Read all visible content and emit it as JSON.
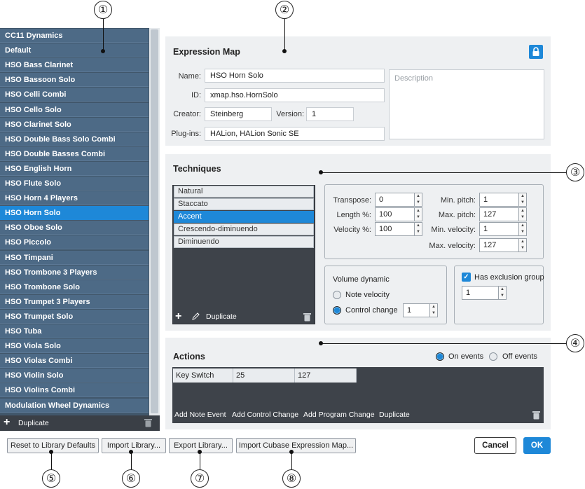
{
  "library": {
    "items": [
      "CC11 Dynamics",
      "Default",
      "HSO Bass Clarinet",
      "HSO Bassoon Solo",
      "HSO Celli Combi",
      "HSO Cello Solo",
      "HSO Clarinet Solo",
      "HSO Double Bass Solo Combi",
      "HSO Double Basses Combi",
      "HSO English Horn",
      "HSO Flute Solo",
      "HSO Horn 4 Players",
      "HSO Horn Solo",
      "HSO Oboe Solo",
      "HSO Piccolo",
      "HSO Timpani",
      "HSO Trombone 3 Players",
      "HSO Trombone Solo",
      "HSO Trumpet 3 Players",
      "HSO Trumpet Solo",
      "HSO Tuba",
      "HSO Viola Solo",
      "HSO Violas Combi",
      "HSO Violin Solo",
      "HSO Violins Combi",
      "Modulation Wheel Dynamics"
    ],
    "selected_index": 12,
    "toolbar": {
      "add_icon": "plus-icon",
      "duplicate_label": "Duplicate",
      "delete_icon": "trash-icon"
    }
  },
  "expression_map": {
    "title": "Expression Map",
    "lock_icon": "lock-icon",
    "name_label": "Name:",
    "name_value": "HSO Horn Solo",
    "id_label": "ID:",
    "id_value": "xmap.hso.HornSolo",
    "creator_label": "Creator:",
    "creator_value": "Steinberg",
    "version_label": "Version:",
    "version_value": "1",
    "plugins_label": "Plug-ins:",
    "plugins_value": "HALion, HALion Sonic SE",
    "description_placeholder": "Description"
  },
  "techniques": {
    "title": "Techniques",
    "items": [
      "Natural",
      "Staccato",
      "Accent",
      "Crescendo-diminuendo",
      "Diminuendo"
    ],
    "selected_index": 2,
    "toolbar": {
      "add_icon": "plus-icon",
      "edit_icon": "pencil-icon",
      "duplicate_label": "Duplicate",
      "delete_icon": "trash-icon"
    },
    "params": {
      "transpose_label": "Transpose:",
      "transpose_value": "0",
      "length_label": "Length %:",
      "length_value": "100",
      "velocity_label": "Velocity %:",
      "velocity_value": "100",
      "min_pitch_label": "Min. pitch:",
      "min_pitch_value": "1",
      "max_pitch_label": "Max. pitch:",
      "max_pitch_value": "127",
      "min_velocity_label": "Min. velocity:",
      "min_velocity_value": "1",
      "max_velocity_label": "Max. velocity:",
      "max_velocity_value": "127"
    },
    "volume_dynamic": {
      "title": "Volume dynamic",
      "note_velocity_label": "Note velocity",
      "control_change_label": "Control change",
      "control_change_value": "1",
      "selected": "control_change"
    },
    "exclusion": {
      "label": "Has exclusion group",
      "checked": true,
      "value": "1"
    }
  },
  "actions": {
    "title": "Actions",
    "on_events_label": "On events",
    "off_events_label": "Off events",
    "selected": "on_events",
    "row": [
      "Key Switch",
      "25",
      "127"
    ],
    "toolbar": [
      "Add Note Event",
      "Add Control Change",
      "Add Program Change",
      "Duplicate"
    ],
    "delete_icon": "trash-icon"
  },
  "footer": {
    "reset_label": "Reset to Library Defaults",
    "import_label": "Import Library...",
    "export_label": "Export Library...",
    "import_cubase_label": "Import Cubase Expression Map...",
    "cancel_label": "Cancel",
    "ok_label": "OK"
  },
  "callouts": [
    "①",
    "②",
    "③",
    "④",
    "⑤",
    "⑥",
    "⑦",
    "⑧"
  ]
}
